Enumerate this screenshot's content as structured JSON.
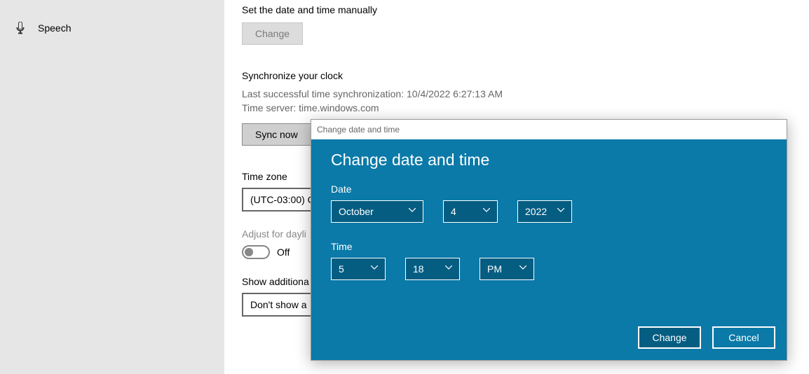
{
  "sidebar": {
    "speech_label": "Speech"
  },
  "main": {
    "set_manual_label": "Set the date and time manually",
    "change_btn": "Change",
    "sync_heading": "Synchronize your clock",
    "sync_last": "Last successful time synchronization: 10/4/2022 6:27:13 AM",
    "sync_server": "Time server: time.windows.com",
    "sync_now_btn": "Sync now",
    "tz_heading": "Time zone",
    "tz_value": "(UTC-03:00) C",
    "adjust_label": "Adjust for dayli",
    "adjust_state": "Off",
    "additional_label": "Show additiona",
    "additional_value": "Don't show a"
  },
  "dialog": {
    "titlebar": "Change date and time",
    "title": "Change date and time",
    "date_label": "Date",
    "month": "October",
    "day": "4",
    "year": "2022",
    "time_label": "Time",
    "hour": "5",
    "minute": "18",
    "ampm": "PM",
    "change_btn": "Change",
    "cancel_btn": "Cancel"
  }
}
